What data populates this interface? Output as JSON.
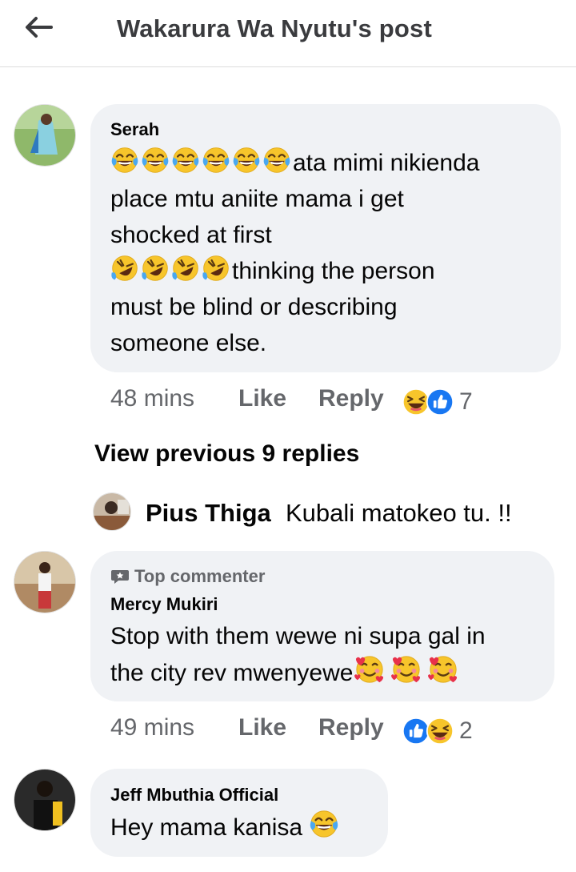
{
  "header": {
    "title": "Wakarura Wa Nyutu's post",
    "back_icon": "back-arrow-icon"
  },
  "comments": [
    {
      "author": "Serah",
      "lines": [
        "ata mimi nikienda",
        "place mtu aniite mama i get",
        "shocked at first",
        "thinking the person",
        "must be blind or describing",
        "someone else."
      ],
      "time": "48 mins",
      "like_label": "Like",
      "reply_label": "Reply",
      "reaction_count": "7",
      "reactions": [
        "haha-icon",
        "like-icon"
      ]
    },
    {
      "badge": "Top commenter",
      "author": "Mercy Mukiri",
      "lines": [
        "Stop with them wewe ni supa gal in",
        "the city rev mwenyewe"
      ],
      "time": "49 mins",
      "like_label": "Like",
      "reply_label": "Reply",
      "reaction_count": "2",
      "reactions": [
        "like-icon",
        "haha-icon"
      ]
    },
    {
      "author": "Jeff Mbuthia Official",
      "lines": [
        "Hey mama kanisa"
      ]
    }
  ],
  "view_previous": "View previous 9 replies",
  "reply": {
    "author": "Pius Thiga",
    "text": "Kubali matokeo tu. !!"
  },
  "colors": {
    "bubble": "#f0f2f5",
    "meta_text": "#65676b",
    "like_blue": "#1877f2",
    "emoji_yellow": "#f7c52b"
  }
}
